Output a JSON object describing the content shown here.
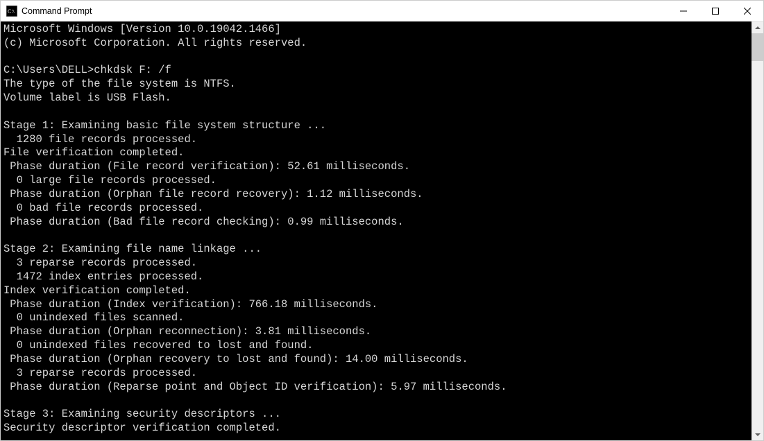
{
  "window": {
    "title": "Command Prompt"
  },
  "terminal": {
    "lines": [
      "Microsoft Windows [Version 10.0.19042.1466]",
      "(c) Microsoft Corporation. All rights reserved.",
      "",
      "C:\\Users\\DELL>chkdsk F: /f",
      "The type of the file system is NTFS.",
      "Volume label is USB Flash.",
      "",
      "Stage 1: Examining basic file system structure ...",
      "  1280 file records processed.",
      "File verification completed.",
      " Phase duration (File record verification): 52.61 milliseconds.",
      "  0 large file records processed.",
      " Phase duration (Orphan file record recovery): 1.12 milliseconds.",
      "  0 bad file records processed.",
      " Phase duration (Bad file record checking): 0.99 milliseconds.",
      "",
      "Stage 2: Examining file name linkage ...",
      "  3 reparse records processed.",
      "  1472 index entries processed.",
      "Index verification completed.",
      " Phase duration (Index verification): 766.18 milliseconds.",
      "  0 unindexed files scanned.",
      " Phase duration (Orphan reconnection): 3.81 milliseconds.",
      "  0 unindexed files recovered to lost and found.",
      " Phase duration (Orphan recovery to lost and found): 14.00 milliseconds.",
      "  3 reparse records processed.",
      " Phase duration (Reparse point and Object ID verification): 5.97 milliseconds.",
      "",
      "Stage 3: Examining security descriptors ...",
      "Security descriptor verification completed."
    ]
  }
}
